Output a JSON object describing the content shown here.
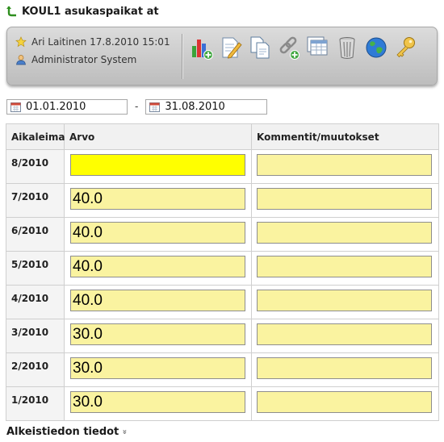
{
  "header": {
    "title": "KOUL1 asukaspaikat at"
  },
  "toolbar": {
    "created_by": "Ari Laitinen 17.8.2010 15:01",
    "user": "Administrator System",
    "icons": [
      "chart-add-icon",
      "edit-document-icon",
      "copy-document-icon",
      "link-add-icon",
      "table-icon",
      "delete-bin-icon",
      "globe-icon",
      "key-icon"
    ]
  },
  "dates": {
    "start": "01.01.2010",
    "separator": "-",
    "end": "31.08.2010"
  },
  "table": {
    "headers": [
      "Aikaleima",
      "Arvo",
      "Kommentit/muutokset"
    ],
    "rows": [
      {
        "timestamp": "8/2010",
        "value": "",
        "comment": ""
      },
      {
        "timestamp": "7/2010",
        "value": "40.0",
        "comment": ""
      },
      {
        "timestamp": "6/2010",
        "value": "40.0",
        "comment": ""
      },
      {
        "timestamp": "5/2010",
        "value": "40.0",
        "comment": ""
      },
      {
        "timestamp": "4/2010",
        "value": "40.0",
        "comment": ""
      },
      {
        "timestamp": "3/2010",
        "value": "30.0",
        "comment": ""
      },
      {
        "timestamp": "2/2010",
        "value": "30.0",
        "comment": ""
      },
      {
        "timestamp": "1/2010",
        "value": "30.0",
        "comment": ""
      }
    ]
  },
  "footer": {
    "label": "Alkeistiedon tiedot",
    "chevron": "»"
  },
  "colors": {
    "active_field": "#ffff00",
    "field": "#faf3a0",
    "toolbar": "#c9c9c9"
  }
}
